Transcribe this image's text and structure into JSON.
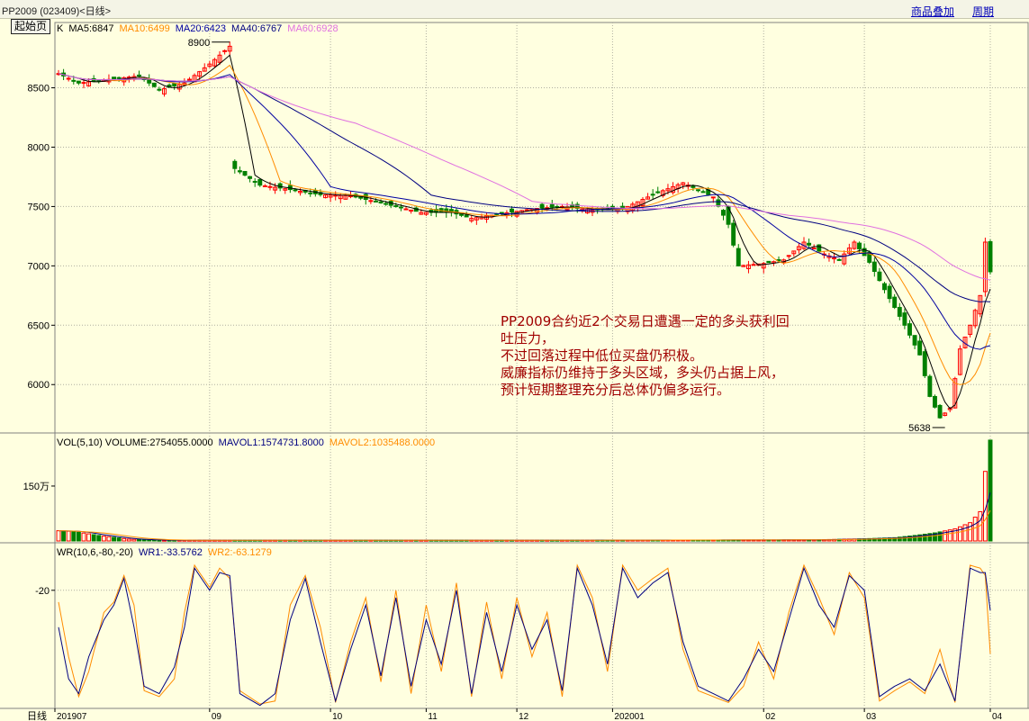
{
  "header": {
    "symbol": "PP2009 (023409)<日线>",
    "home_button": "起始页",
    "links": [
      "商品叠加",
      "周期"
    ]
  },
  "price_panel": {
    "legend": [
      {
        "label": "K",
        "color": "#000000"
      },
      {
        "label": "MA5:6847",
        "color": "#000000"
      },
      {
        "label": "MA10:6499",
        "color": "#ff8c00"
      },
      {
        "label": "MA20:6423",
        "color": "#0000a0"
      },
      {
        "label": "MA40:6767",
        "color": "#000080"
      },
      {
        "label": "MA60:6928",
        "color": "#e070e0"
      }
    ],
    "high_marker": "8900",
    "low_marker": "5638"
  },
  "volume_panel": {
    "legend": [
      {
        "label": "VOL(5,10) VOLUME:2754055.0000",
        "color": "#000000"
      },
      {
        "label": "MAVOL1:1574731.8000",
        "color": "#000080"
      },
      {
        "label": "MAVOL2:1035488.0000",
        "color": "#ff8c00"
      }
    ]
  },
  "wr_panel": {
    "legend": [
      {
        "label": "WR(10,6,-80,-20)",
        "color": "#000000"
      },
      {
        "label": "WR1:-33.5762",
        "color": "#000080"
      },
      {
        "label": "WR2:-63.1279",
        "color": "#ff8c00"
      }
    ]
  },
  "annotation": [
    "PP2009合约近2个交易日遭遇一定的多头获利回",
    "吐压力，",
    "不过回落过程中低位买盘仍积极。",
    "威廉指标仍维持于多头区域，多头仍占据上风，",
    "预计短期整理充分后总体仍偏多运行。"
  ],
  "footer": {
    "period_label": "日线"
  },
  "colors": {
    "up": "#ff0000",
    "down": "#008000",
    "background": "#ffffe0"
  },
  "chart_data": [
    {
      "type": "candlestick",
      "title": "PP2009 日线",
      "x_ticks": [
        "201907",
        "09",
        "10",
        "11",
        "12",
        "202001",
        "02",
        "03",
        "04"
      ],
      "ylim": [
        5600,
        9050
      ],
      "y_ticks": [
        6000,
        6500,
        7000,
        7500,
        8000,
        8500
      ],
      "grid": true,
      "anchors": [
        [
          0,
          8620
        ],
        [
          4,
          8540
        ],
        [
          8,
          8560
        ],
        [
          12,
          8580
        ],
        [
          16,
          8600
        ],
        [
          20,
          8480
        ],
        [
          25,
          8540
        ],
        [
          30,
          8700
        ],
        [
          34,
          8850
        ],
        [
          35,
          7820
        ],
        [
          40,
          7680
        ],
        [
          45,
          7650
        ],
        [
          52,
          7600
        ],
        [
          58,
          7590
        ],
        [
          66,
          7510
        ],
        [
          72,
          7450
        ],
        [
          78,
          7450
        ],
        [
          82,
          7400
        ],
        [
          88,
          7440
        ],
        [
          94,
          7480
        ],
        [
          100,
          7500
        ],
        [
          106,
          7470
        ],
        [
          112,
          7480
        ],
        [
          118,
          7600
        ],
        [
          124,
          7700
        ],
        [
          126,
          7660
        ],
        [
          130,
          7580
        ],
        [
          133,
          7350
        ],
        [
          135,
          7000
        ],
        [
          140,
          7020
        ],
        [
          144,
          7050
        ],
        [
          148,
          7200
        ],
        [
          152,
          7100
        ],
        [
          155,
          7050
        ],
        [
          158,
          7200
        ],
        [
          161,
          7030
        ],
        [
          164,
          6800
        ],
        [
          168,
          6500
        ],
        [
          171,
          6250
        ],
        [
          173,
          5900
        ],
        [
          175,
          5720
        ],
        [
          177,
          5800
        ],
        [
          179,
          6300
        ],
        [
          181,
          6500
        ],
        [
          183,
          6750
        ],
        [
          184,
          7200
        ],
        [
          185,
          6950
        ]
      ],
      "moving_averages": [
        {
          "name": "MA5",
          "value": 6847
        },
        {
          "name": "MA10",
          "value": 6499
        },
        {
          "name": "MA20",
          "value": 6423
        },
        {
          "name": "MA40",
          "value": 6767
        },
        {
          "name": "MA60",
          "value": 6928
        }
      ],
      "high": 8900,
      "low": 5638
    },
    {
      "type": "bar",
      "title": "VOL(5,10)",
      "y_ticks": [
        1500000
      ],
      "y_tick_labels": [
        "150万"
      ],
      "ylim": [
        0,
        2900000
      ],
      "last_volume": 2754055,
      "anchors": [
        [
          0,
          280000
        ],
        [
          3,
          260000
        ],
        [
          8,
          150000
        ],
        [
          14,
          50000
        ],
        [
          20,
          20000
        ],
        [
          40,
          20000
        ],
        [
          100,
          20000
        ],
        [
          150,
          30000
        ],
        [
          160,
          60000
        ],
        [
          166,
          90000
        ],
        [
          170,
          150000
        ],
        [
          174,
          220000
        ],
        [
          178,
          330000
        ],
        [
          181,
          500000
        ],
        [
          183,
          800000
        ],
        [
          184,
          1900000
        ],
        [
          185,
          2754055
        ]
      ],
      "mavol1": 1574731.8,
      "mavol2": 1035488.0
    },
    {
      "type": "line",
      "title": "WR(10,6,-80,-20)",
      "ylim": [
        -100,
        0
      ],
      "y_ticks": [
        -20
      ],
      "series": [
        {
          "name": "WR1",
          "last": -33.5762,
          "anchors": [
            [
              0,
              -45
            ],
            [
              2,
              -80
            ],
            [
              4,
              -90
            ],
            [
              6,
              -65
            ],
            [
              9,
              -40
            ],
            [
              11,
              -30
            ],
            [
              13,
              -12
            ],
            [
              15,
              -45
            ],
            [
              17,
              -85
            ],
            [
              20,
              -90
            ],
            [
              23,
              -72
            ],
            [
              25,
              -45
            ],
            [
              27,
              -5
            ],
            [
              30,
              -20
            ],
            [
              32,
              -8
            ],
            [
              34,
              -10
            ],
            [
              36,
              -90
            ],
            [
              40,
              -98
            ],
            [
              43,
              -90
            ],
            [
              46,
              -40
            ],
            [
              49,
              -12
            ],
            [
              52,
              -55
            ],
            [
              55,
              -95
            ],
            [
              58,
              -60
            ],
            [
              61,
              -30
            ],
            [
              64,
              -78
            ],
            [
              67,
              -25
            ],
            [
              70,
              -85
            ],
            [
              73,
              -40
            ],
            [
              76,
              -70
            ],
            [
              79,
              -20
            ],
            [
              82,
              -90
            ],
            [
              85,
              -35
            ],
            [
              88,
              -75
            ],
            [
              91,
              -30
            ],
            [
              94,
              -60
            ],
            [
              97,
              -40
            ],
            [
              100,
              -88
            ],
            [
              103,
              -5
            ],
            [
              106,
              -30
            ],
            [
              109,
              -70
            ],
            [
              112,
              -5
            ],
            [
              115,
              -25
            ],
            [
              118,
              -15
            ],
            [
              121,
              -8
            ],
            [
              124,
              -55
            ],
            [
              127,
              -85
            ],
            [
              130,
              -90
            ],
            [
              133,
              -95
            ],
            [
              136,
              -80
            ],
            [
              139,
              -60
            ],
            [
              142,
              -75
            ],
            [
              145,
              -40
            ],
            [
              148,
              -5
            ],
            [
              151,
              -30
            ],
            [
              154,
              -45
            ],
            [
              157,
              -10
            ],
            [
              160,
              -20
            ],
            [
              163,
              -92
            ],
            [
              166,
              -85
            ],
            [
              169,
              -80
            ],
            [
              172,
              -88
            ],
            [
              175,
              -70
            ],
            [
              178,
              -95
            ],
            [
              181,
              -5
            ],
            [
              183,
              -8
            ],
            [
              184,
              -8
            ],
            [
              185,
              -33.6
            ]
          ]
        },
        {
          "name": "WR2",
          "last": -63.1279,
          "anchors": [
            [
              0,
              -28
            ],
            [
              2,
              -65
            ],
            [
              4,
              -92
            ],
            [
              6,
              -75
            ],
            [
              9,
              -35
            ],
            [
              11,
              -28
            ],
            [
              13,
              -10
            ],
            [
              15,
              -30
            ],
            [
              17,
              -88
            ],
            [
              20,
              -92
            ],
            [
              23,
              -80
            ],
            [
              25,
              -35
            ],
            [
              27,
              -3
            ],
            [
              30,
              -18
            ],
            [
              32,
              -5
            ],
            [
              34,
              -12
            ],
            [
              36,
              -88
            ],
            [
              40,
              -97
            ],
            [
              43,
              -95
            ],
            [
              46,
              -30
            ],
            [
              49,
              -10
            ],
            [
              52,
              -45
            ],
            [
              55,
              -96
            ],
            [
              58,
              -55
            ],
            [
              61,
              -25
            ],
            [
              64,
              -82
            ],
            [
              67,
              -20
            ],
            [
              70,
              -90
            ],
            [
              73,
              -30
            ],
            [
              76,
              -75
            ],
            [
              79,
              -15
            ],
            [
              82,
              -92
            ],
            [
              85,
              -28
            ],
            [
              88,
              -80
            ],
            [
              91,
              -25
            ],
            [
              94,
              -65
            ],
            [
              97,
              -35
            ],
            [
              100,
              -92
            ],
            [
              103,
              -3
            ],
            [
              106,
              -25
            ],
            [
              109,
              -75
            ],
            [
              112,
              -3
            ],
            [
              115,
              -20
            ],
            [
              118,
              -12
            ],
            [
              121,
              -5
            ],
            [
              124,
              -60
            ],
            [
              127,
              -88
            ],
            [
              130,
              -92
            ],
            [
              133,
              -96
            ],
            [
              136,
              -85
            ],
            [
              139,
              -55
            ],
            [
              142,
              -80
            ],
            [
              145,
              -35
            ],
            [
              148,
              -3
            ],
            [
              151,
              -25
            ],
            [
              154,
              -50
            ],
            [
              157,
              -8
            ],
            [
              160,
              -25
            ],
            [
              163,
              -95
            ],
            [
              166,
              -88
            ],
            [
              169,
              -82
            ],
            [
              172,
              -90
            ],
            [
              175,
              -60
            ],
            [
              178,
              -96
            ],
            [
              181,
              -3
            ],
            [
              183,
              -5
            ],
            [
              184,
              -10
            ],
            [
              185,
              -63.1
            ]
          ]
        }
      ]
    }
  ]
}
